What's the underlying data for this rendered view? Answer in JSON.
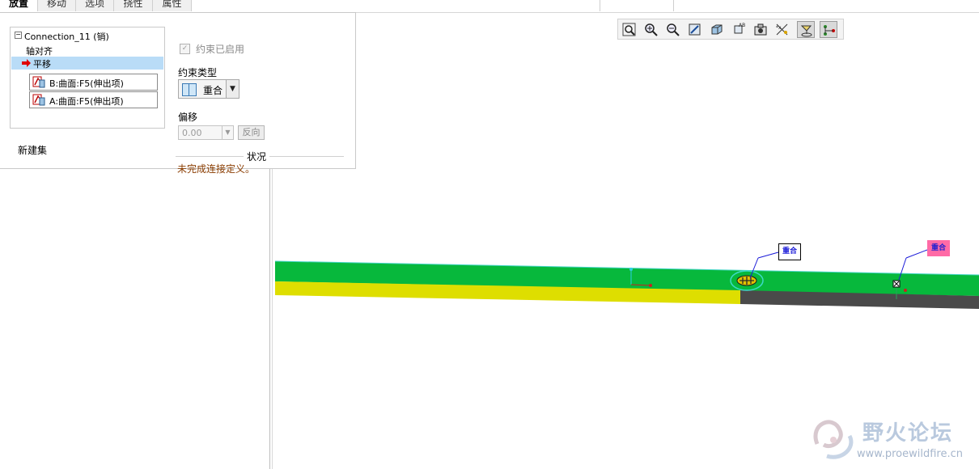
{
  "tabs": [
    {
      "label": "放置",
      "active": true
    },
    {
      "label": "移动",
      "active": false
    },
    {
      "label": "选项",
      "active": false
    },
    {
      "label": "挠性",
      "active": false
    },
    {
      "label": "属性",
      "active": false
    }
  ],
  "placement": {
    "connection_title": "Connection_11 (销)",
    "constraints": [
      "轴对齐",
      "平移"
    ],
    "selected_constraint": "平移",
    "references": [
      "B:曲面:F5(伸出项)",
      "A:曲面:F5(伸出项)"
    ],
    "new_set_label": "新建集",
    "constraint_enabled_label": "约束已启用",
    "constraint_type_label": "约束类型",
    "constraint_type_value": "重合",
    "offset_label": "偏移",
    "offset_value": "0.00",
    "reverse_button": "反向",
    "status_label": "状况",
    "status_message": "未完成连接定义。"
  },
  "viewport": {
    "tag_coincident_1": "重合",
    "tag_coincident_2": "重合"
  },
  "graphics_toolbar": {
    "icons": [
      "zoom-fit-icon",
      "zoom-in-icon",
      "zoom-out-icon",
      "repaint-icon",
      "orient-icon",
      "saved-views-icon",
      "display-style-icon",
      "datum-display-icon",
      "spin-center-icon",
      "connection-display-icon"
    ]
  },
  "watermark": {
    "title": "野火论坛",
    "url": "www.proewildfire.cn"
  },
  "colors": {
    "green_surface": "#07b83c",
    "yellow_surface": "#dede00",
    "dark_surface": "#4a4a4a",
    "selection": "#b9dcf7",
    "status_text": "#8a3c00",
    "tag_pink": "#ff6aa6"
  }
}
